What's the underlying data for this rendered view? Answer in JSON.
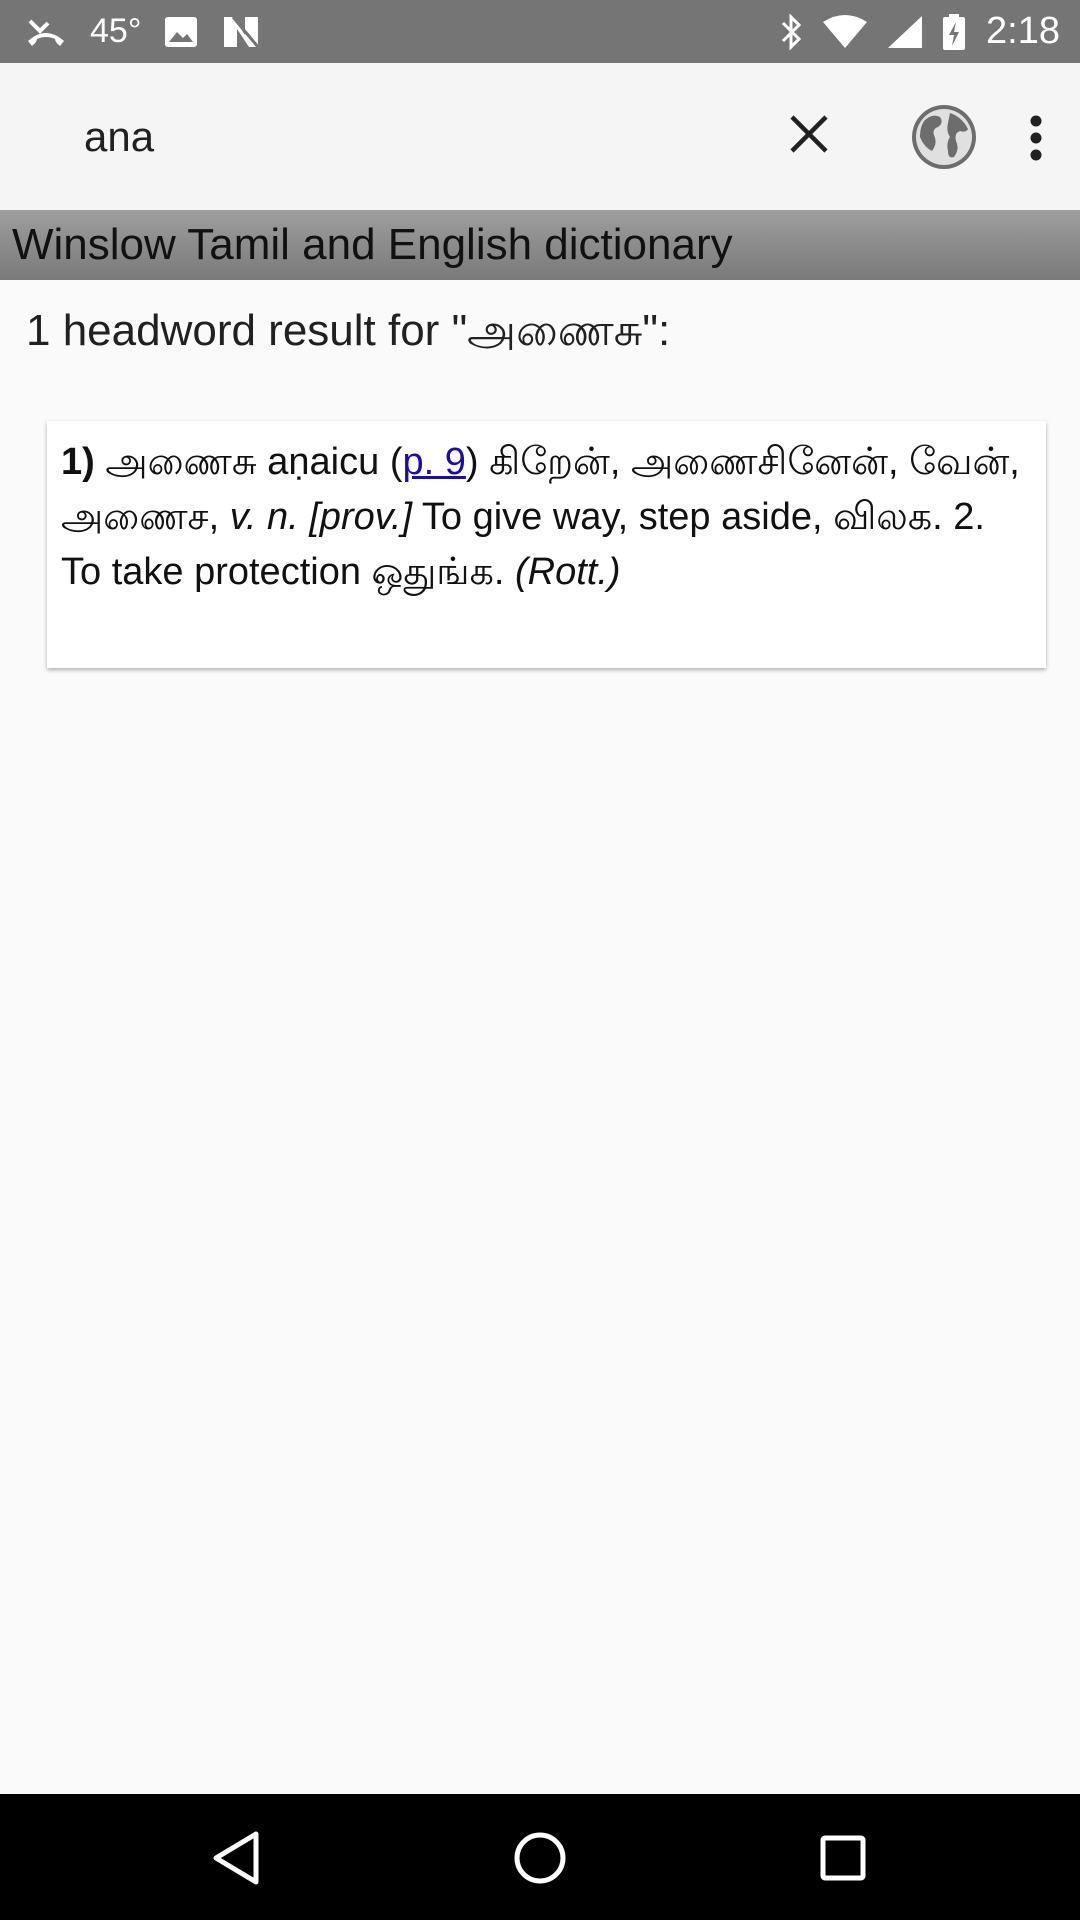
{
  "status_bar": {
    "temperature": "45°",
    "time": "2:18"
  },
  "search": {
    "query": "ana"
  },
  "dictionary": {
    "name": "Winslow Tamil and English dictionary"
  },
  "results": {
    "summary": "1 headword result for \"அணைசு\":"
  },
  "entry": {
    "number": "1)",
    "headword": "அணைசு",
    "transliteration": "aṇaicu",
    "paren_open": "(",
    "page_link": "p. 9",
    "after_link": ") கிறேன், அணைசினேன், வேன், அணைச, ",
    "grammar": "v. n. [prov.]",
    "definition": " To give way, step aside, விலக. 2. To take protection ஒதுங்க. ",
    "source": "(Rott.)"
  }
}
